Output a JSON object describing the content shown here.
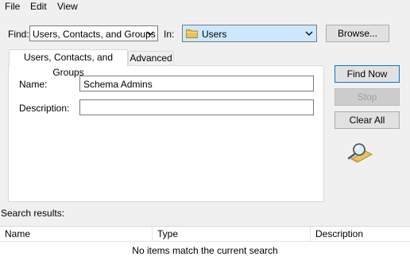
{
  "menu": [
    "File",
    "Edit",
    "View"
  ],
  "find_row": {
    "find_label": "Find:",
    "find_value": "Users, Contacts, and Groups",
    "in_label": "In:",
    "in_value": "Users",
    "browse_label": "Browse..."
  },
  "tabs": [
    "Users, Contacts, and Groups",
    "Advanced"
  ],
  "form": {
    "name_label": "Name:",
    "name_value": "Schema Admins",
    "description_label": "Description:",
    "description_value": ""
  },
  "buttons": {
    "find_now": "Find Now",
    "stop": "Stop",
    "clear_all": "Clear All"
  },
  "results": {
    "label": "Search results:",
    "columns": [
      "Name",
      "Type",
      "Description"
    ],
    "empty_message": "No items match the current search"
  },
  "icons": {
    "folder": "folder-icon",
    "search": "magnifier-icon",
    "dropdown": "chevron-down-icon"
  },
  "colors": {
    "in_combo_bg": "#cce8ff",
    "folder": "#e8c25a",
    "default_button_border": "#0078d7"
  }
}
